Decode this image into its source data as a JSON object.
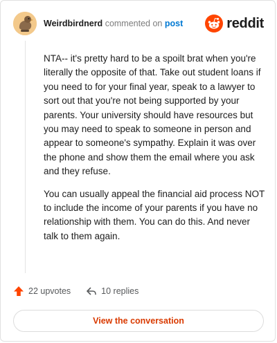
{
  "header": {
    "author": "Weirdbirdnerd",
    "action_text": "commented on",
    "post_link": "post"
  },
  "brand": {
    "wordmark": "reddit",
    "logo_icon": "reddit-snoo-icon",
    "accent_color": "#ff4500"
  },
  "comment": {
    "paragraphs": [
      "NTA-- it's pretty hard to be a spoilt brat when you're literally the opposite of that. Take out student loans if you need to for your final year, speak to a lawyer to sort out that you're not being supported by your parents. Your university should have resources but you may need to speak to someone in person and appear to someone's sympathy. Explain it was over the phone and show them the email where you ask and they refuse.",
      "You can usually appeal the financial aid process NOT to include the income of your parents if you have no relationship with them. You can do this. And never talk to them again."
    ]
  },
  "actions": {
    "upvotes": "22 upvotes",
    "upvote_icon": "upvote-arrow-icon",
    "replies": "10 replies",
    "reply_icon": "reply-arrow-icon"
  },
  "footer": {
    "button_label": "View the conversation",
    "button_color": "#d93a00"
  }
}
